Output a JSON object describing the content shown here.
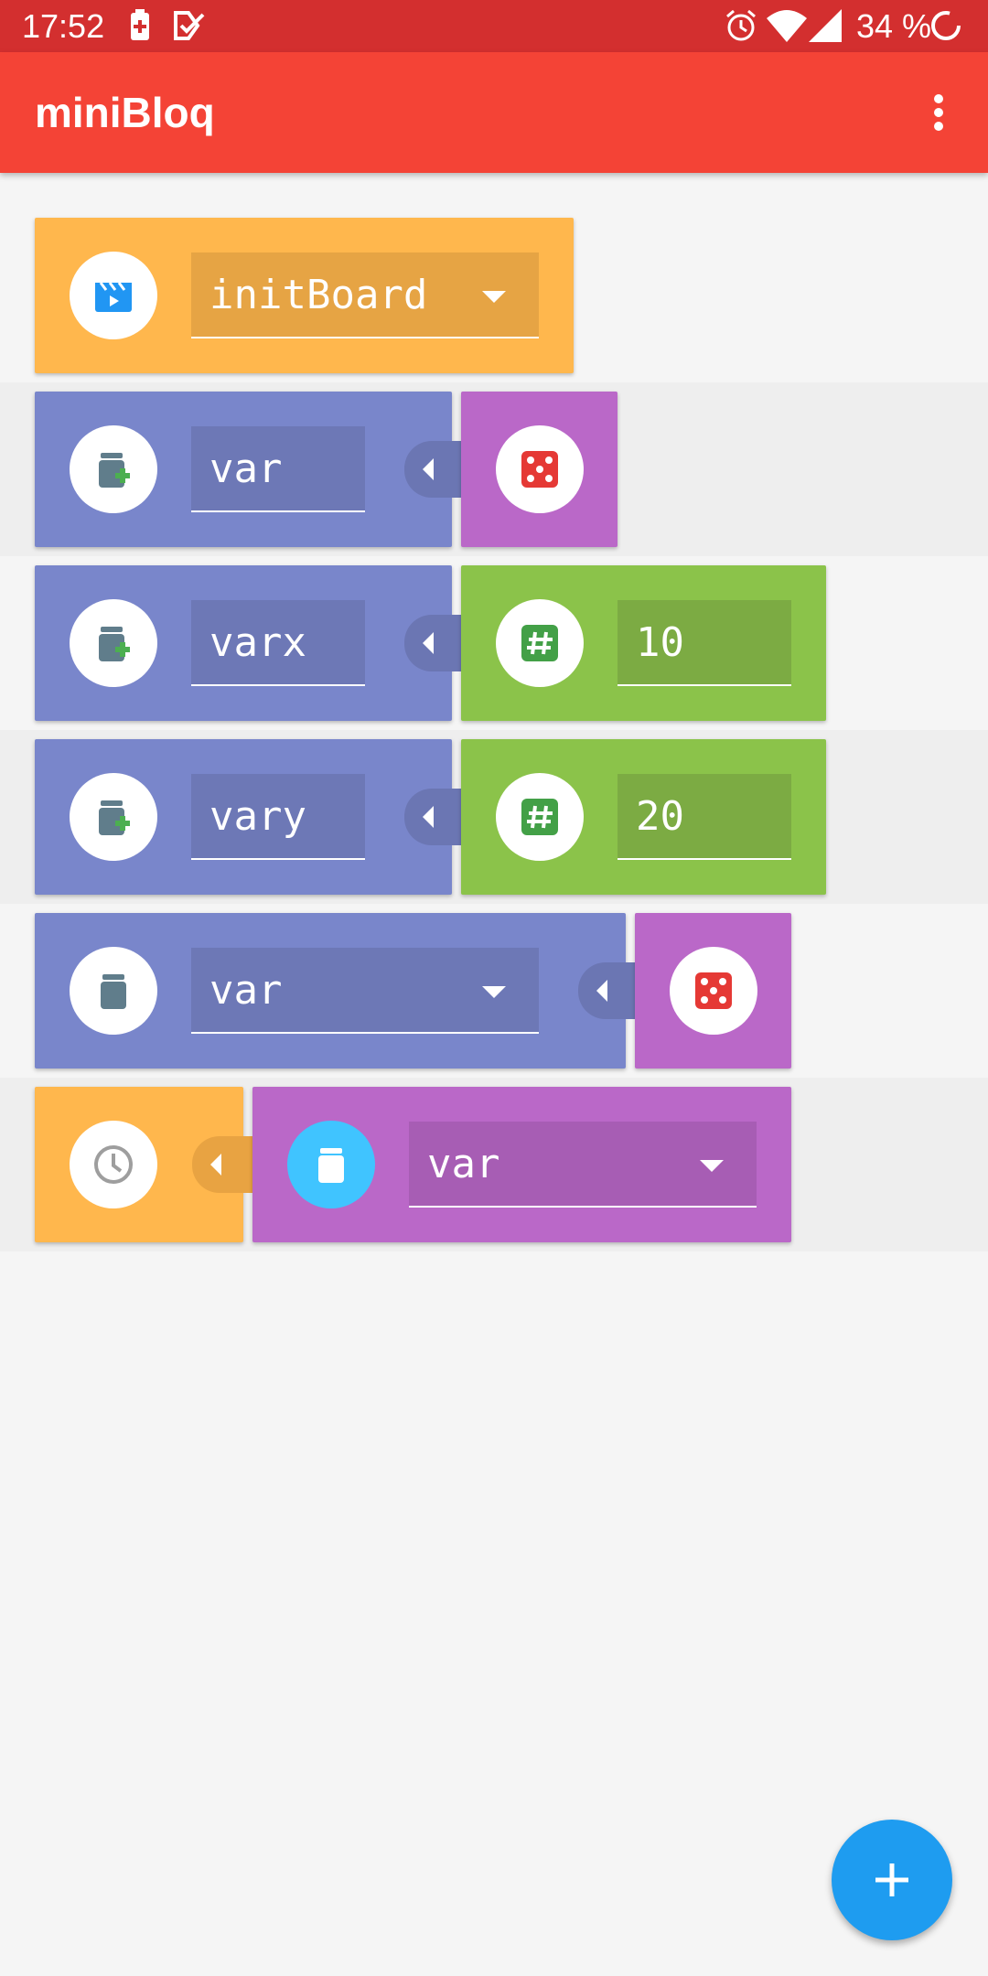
{
  "status_bar": {
    "time": "17:52",
    "battery_percent": "34 %",
    "icons": [
      "battery-saver-icon",
      "task-check-icon",
      "alarm-icon",
      "wifi-icon",
      "signal-icon",
      "loading-ring-icon"
    ]
  },
  "app_bar": {
    "title": "miniBloq",
    "overflow_icon": "more-vert-icon"
  },
  "blocks": [
    {
      "type": "event",
      "icon": "clapperboard-icon",
      "field": "initBoard",
      "dropdown": true
    },
    {
      "type": "declare-variable",
      "icon": "jar-add-icon",
      "field": "var",
      "value_block": {
        "icon": "dice-icon"
      }
    },
    {
      "type": "declare-variable",
      "icon": "jar-add-icon",
      "field": "varx",
      "value_block": {
        "icon": "hash-icon",
        "value": "10"
      }
    },
    {
      "type": "declare-variable",
      "icon": "jar-add-icon",
      "field": "vary",
      "value_block": {
        "icon": "hash-icon",
        "value": "20"
      }
    },
    {
      "type": "set-variable",
      "icon": "jar-icon",
      "field": "var",
      "dropdown": true,
      "value_block": {
        "icon": "dice-icon"
      }
    },
    {
      "type": "delay",
      "icon": "clock-icon",
      "value_block": {
        "icon": "jar-icon",
        "field": "var",
        "dropdown": true
      }
    }
  ],
  "fab": {
    "icon": "plus-icon"
  },
  "colors": {
    "status_bar": "#d32f2f",
    "app_bar": "#f44336",
    "orange_block": "#ffb74d",
    "indigo_block": "#7986cb",
    "purple_block": "#ba68c8",
    "green_block": "#8bc34a",
    "fab": "#1e9cf0"
  }
}
